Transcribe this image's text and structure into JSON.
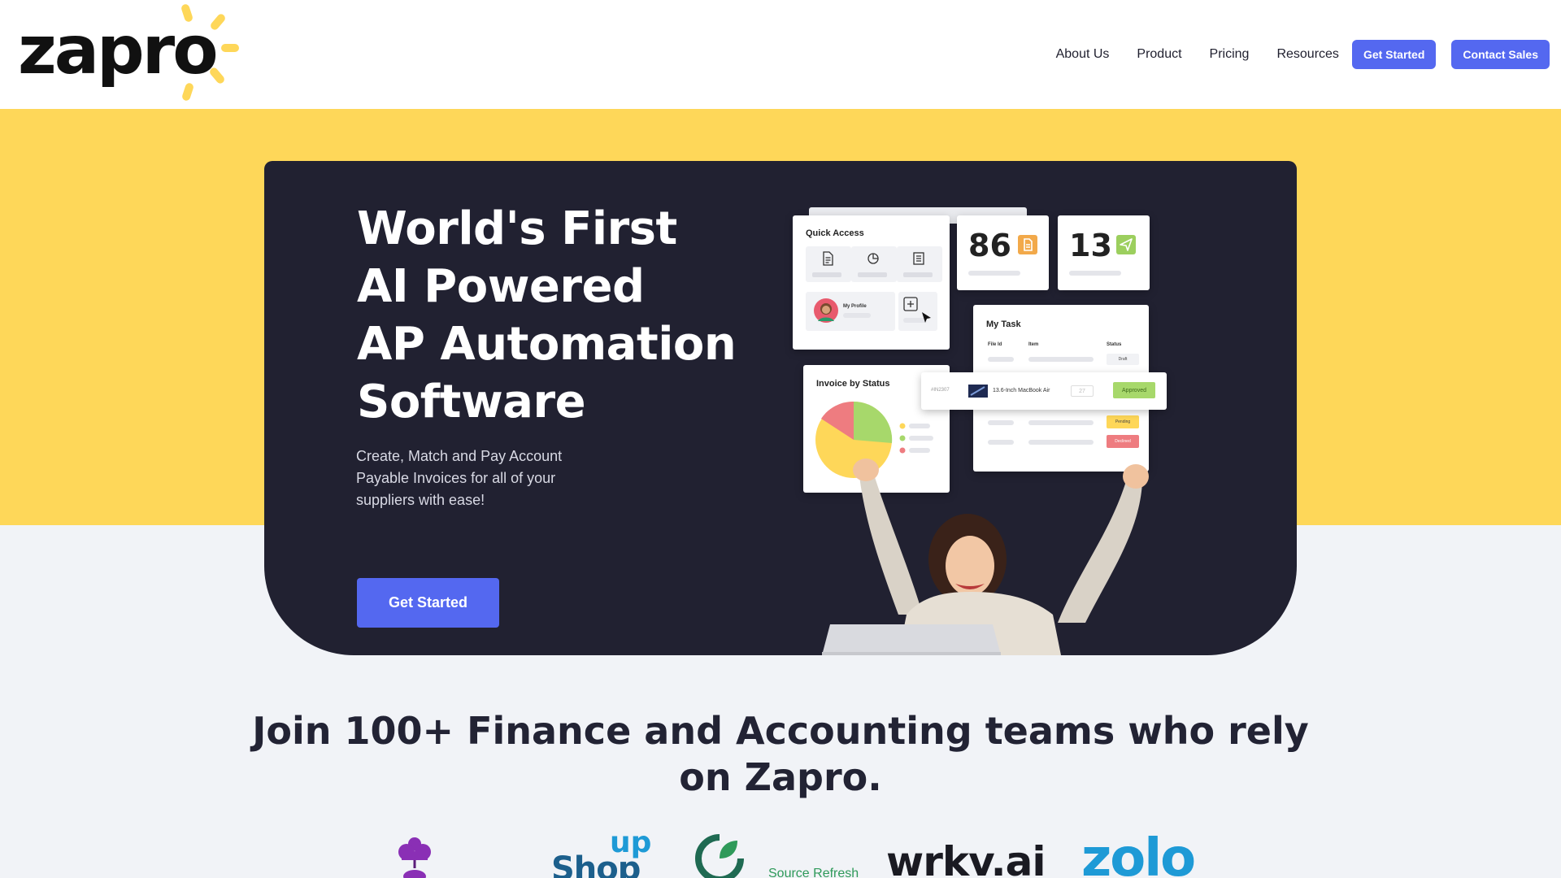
{
  "brand": {
    "name": "zapro",
    "sun_color": "#fed759"
  },
  "nav": {
    "links": [
      "About Us",
      "Product",
      "Pricing",
      "Resources"
    ],
    "get_started": "Get Started",
    "contact_sales": "Contact Sales"
  },
  "colors": {
    "accent": "#5468f0",
    "yellow": "#fed759",
    "hero_bg": "#212131",
    "page_bg": "#f1f3f7"
  },
  "hero": {
    "title_lines": [
      "World's First",
      "AI Powered",
      "AP Automation",
      "Software"
    ],
    "subtitle": "Create, Match and Pay Account Payable Invoices for all of your suppliers with ease!",
    "cta": "Get Started"
  },
  "dashboard": {
    "quick_access_title": "Quick Access",
    "my_profile": "My Profile",
    "stat1_value": "86",
    "stat2_value": "13",
    "my_task_title": "My Task",
    "task_headers": {
      "file_id": "File Id",
      "item": "Item",
      "status": "Status"
    },
    "task_status_draft": "Draft",
    "invoice_title": "Invoice by Status",
    "highlight_row": {
      "id": "#IN2307",
      "item": "13.6-Inch MacBook Air",
      "qty": "27",
      "status": "Approved"
    },
    "pending": "Pending",
    "declined": "Declined"
  },
  "trust": {
    "line1": "Join 100+ Finance and Accounting teams who rely",
    "line2": "on Zapro."
  },
  "partner_logos": [
    "Shopup",
    "Source Refresh",
    "wrkv.ai",
    "zolo"
  ],
  "partner_logo_text": {
    "shop": "Shop",
    "up": "up",
    "source_refresh": "Source Refresh",
    "wrkv": "wrkv.ai",
    "zolo": "zolo"
  }
}
